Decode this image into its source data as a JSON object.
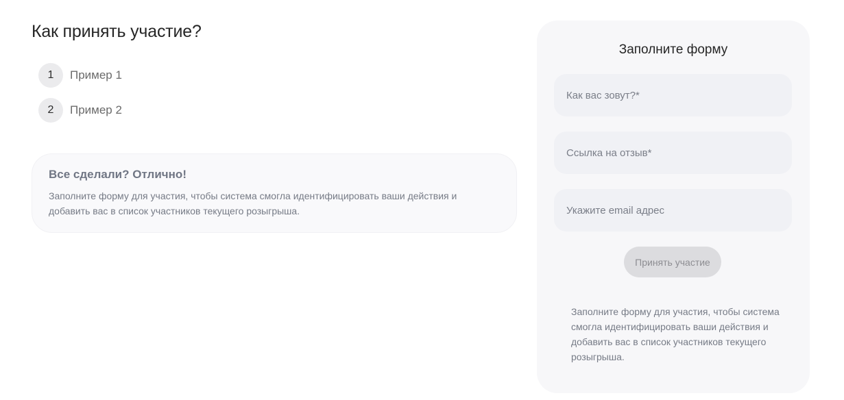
{
  "main": {
    "title": "Как принять участие?",
    "steps": [
      {
        "number": "1",
        "label": "Пример 1"
      },
      {
        "number": "2",
        "label": "Пример 2"
      }
    ],
    "done_card": {
      "title": "Все сделали? Отлично!",
      "text": "Заполните форму для участия, чтобы система смогла идентифицировать ваши действия и добавить вас в список участников текущего розыгрыша."
    }
  },
  "form": {
    "title": "Заполните форму",
    "name_placeholder": "Как вас зовут?*",
    "link_placeholder": "Ссылка на отзыв*",
    "email_placeholder": "Укажите email адрес",
    "submit_label": "Принять участие",
    "note": "Заполните форму для участия, чтобы система смогла идентифицировать ваши действия и добавить вас в список участников текущего розыгрыша."
  }
}
